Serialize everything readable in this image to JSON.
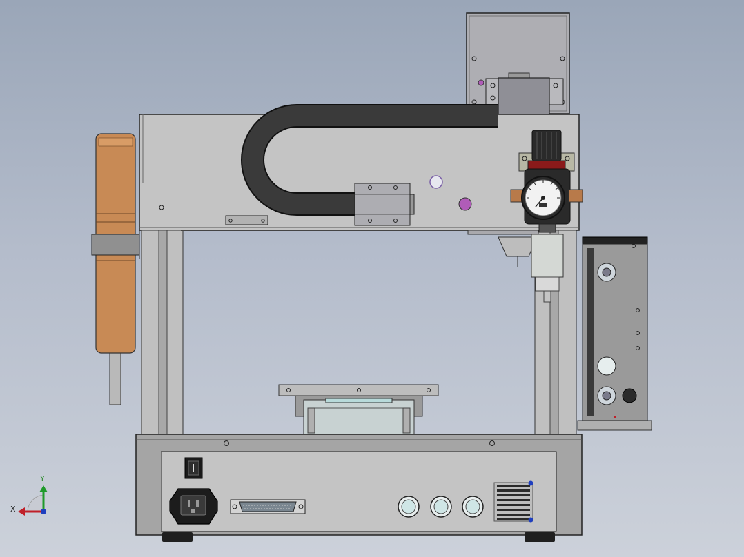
{
  "scene": {
    "title": "",
    "background_top": "#9aa6b8",
    "background_bottom": "#ccd1da"
  },
  "triad": {
    "x_label": "X",
    "y_label": "Y",
    "x_color": "#c0202a",
    "y_color": "#1e9a2a",
    "z_color": "#1f3fbf"
  },
  "colors": {
    "frame": "#c6c6c6",
    "frame_dark": "#8d8d8d",
    "base_front": "#c2c2c2",
    "cable_chain": "#3a3a3a",
    "motor_copper": "#c88a55",
    "gauge_face": "#f2f2f2",
    "regulator_body": "#2a2a2a",
    "control_box": "#9a9a9a",
    "accent_purple": "#b05cb8"
  },
  "components": [
    "gantry-frame",
    "x-axis-beam",
    "cable-drag-chain",
    "z-axis-motor-housing",
    "stepper-motor",
    "pressure-regulator",
    "pressure-gauge",
    "dispensing-syringe",
    "work-platform",
    "control-base",
    "power-switch",
    "power-inlet",
    "db37-connector",
    "circular-connector",
    "vent-grille",
    "side-control-box",
    "support-foot"
  ]
}
